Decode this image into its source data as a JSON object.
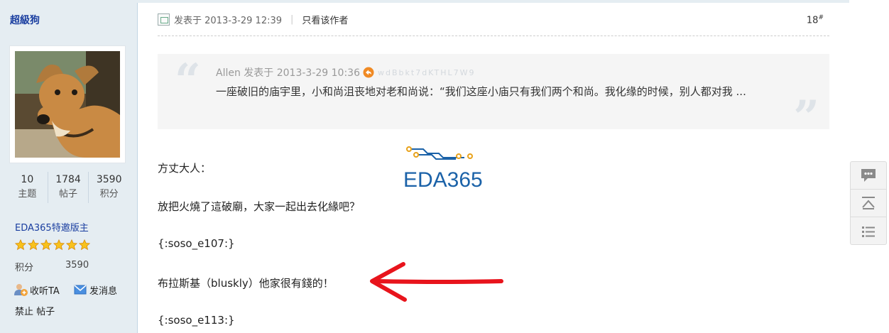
{
  "profile": {
    "username": "超級狗",
    "stats": [
      {
        "value": "10",
        "label": "主题"
      },
      {
        "value": "1784",
        "label": "帖子"
      },
      {
        "value": "3590",
        "label": "积分"
      }
    ],
    "rank": "EDA365特邀版主",
    "star_count": 6,
    "points_label": "积分",
    "points_value": "3590",
    "follow_label": "收听TA",
    "message_label": "发消息",
    "ban_label": "禁止 帖子"
  },
  "post": {
    "posted_at": "发表于 2013-3-29 12:39",
    "only_author": "只看该作者",
    "floor_number": "18",
    "floor_mark": "#",
    "quote": {
      "meta": "Allen 发表于 2013-3-29 10:36",
      "faint_text": "wdBbkt7dKTHL7W9",
      "text": "一座破旧的庙宇里，小和尚沮丧地对老和尚说：“我们这座小庙只有我们两个和尚。我化缘的时候，别人都对我 ..."
    },
    "logo_text": "EDA365",
    "lines": [
      "方丈大人：",
      "放把火燒了這破廟，大家一起出去化緣吧？",
      "{:soso_e107:}",
      "布拉斯基（bluskly）他家很有錢的！",
      "{:soso_e113:}"
    ]
  },
  "colors": {
    "sidebar_bg": "#e5edf2",
    "link_blue": "#1a3ea0",
    "arrow_red": "#e8141c",
    "logo_blue": "#1b62a8",
    "logo_orange": "#e8a21a"
  },
  "icons": {
    "stars": "star-icon",
    "follow": "follow-user-icon",
    "message": "envelope-icon",
    "reply_arrow": "reply-arrow-icon",
    "tools": [
      "comment-icon",
      "back-to-top-icon",
      "list-icon"
    ]
  }
}
